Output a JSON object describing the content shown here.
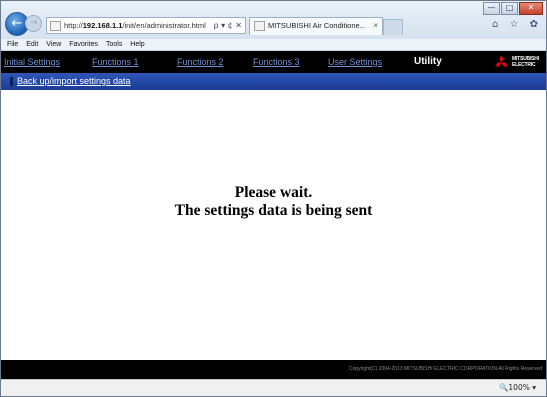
{
  "browser": {
    "address_prefix": "http://",
    "address_host": "192.168.1.1",
    "address_path": "/init/en/administrator.html",
    "address_controls": "ρ ▾ ¢ ✕",
    "tab_title": "MITSUBISHI Air Conditione...",
    "tab_close": "×",
    "window_buttons": {
      "minimize": "—",
      "maximize": "□",
      "close": "✕"
    },
    "toolbar_icons": "⌂ ☆ ✿",
    "menu": [
      "File",
      "Edit",
      "View",
      "Favorites",
      "Tools",
      "Help"
    ],
    "zoom": "🔍100%  ▾"
  },
  "nav": {
    "items": [
      "Initial Settings",
      "Functions 1",
      "Functions 2",
      "Functions 3",
      "User Settings"
    ],
    "active": "Utility",
    "logo_line1": "MITSUBISHI",
    "logo_line2": "ELECTRIC"
  },
  "subnav": {
    "link": "Back up/import settings data"
  },
  "message": {
    "line1": "Please wait.",
    "line2": "The settings data is being sent"
  },
  "footer": {
    "copyright": "Copyright(C) 2004-2013 MITSUBISHI ELECTRIC CORPORATION All Rights Reserved"
  },
  "colors": {
    "nav_bg": "#000000",
    "nav_link": "#6f8fd0",
    "subnav_bg": "#2a4fae",
    "logo_red": "#e60012"
  }
}
